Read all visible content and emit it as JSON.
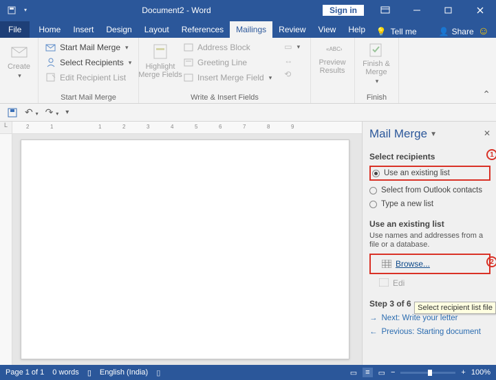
{
  "titlebar": {
    "title": "Document2 - Word",
    "signin": "Sign in"
  },
  "tabs": {
    "file": "File",
    "home": "Home",
    "insert": "Insert",
    "design": "Design",
    "layout": "Layout",
    "references": "References",
    "mailings": "Mailings",
    "review": "Review",
    "view": "View",
    "help": "Help",
    "tellme": "Tell me",
    "share": "Share"
  },
  "ribbon": {
    "create": "Create",
    "startMailMerge": "Start Mail Merge",
    "selectRecipients": "Select Recipients",
    "editRecipientList": "Edit Recipient List",
    "groupStart": "Start Mail Merge",
    "highlightMergeFields": "Highlight\nMerge Fields",
    "addressBlock": "Address Block",
    "greetingLine": "Greeting Line",
    "insertMergeField": "Insert Merge Field",
    "groupWrite": "Write & Insert Fields",
    "previewResults": "Preview\nResults",
    "finishMerge": "Finish &\nMerge",
    "groupFinish": "Finish"
  },
  "taskpane": {
    "title": "Mail Merge",
    "selectRecipientsH": "Select recipients",
    "optExisting": "Use an existing list",
    "optOutlook": "Select from Outlook contacts",
    "optNew": "Type a new list",
    "useExistingH": "Use an existing list",
    "useExistingDesc": "Use names and addresses from a file or a database.",
    "browse": "Browse...",
    "edit": "Edi",
    "tooltip": "Select recipient list file",
    "stepH": "Step 3 of 6",
    "next": "Next: Write your letter",
    "prev": "Previous: Starting document",
    "ann1": "1",
    "ann2": "2"
  },
  "statusbar": {
    "page": "Page 1 of 1",
    "words": "0 words",
    "lang": "English (India)",
    "zoomPct": "100%"
  }
}
